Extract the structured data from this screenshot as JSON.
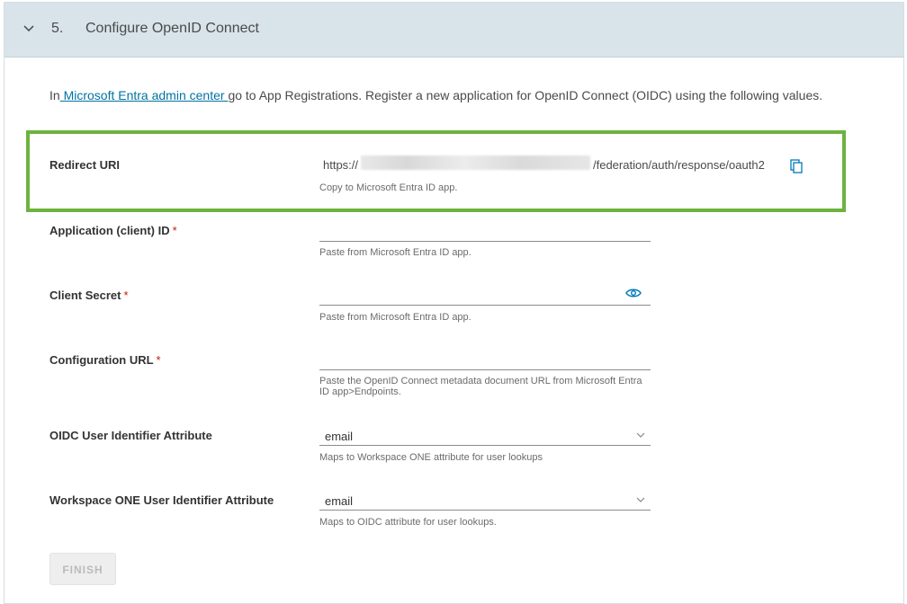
{
  "step": {
    "number": "5.",
    "title": "Configure OpenID Connect",
    "chevron_icon": "chevron-down-icon"
  },
  "intro": {
    "prefix": "In",
    "link_text": " Microsoft Entra admin center ",
    "suffix": "go to App Registrations. Register a new application for OpenID Connect (OIDC) using the following values."
  },
  "redirect_uri": {
    "label": "Redirect URI",
    "value_prefix": "https://",
    "value_suffix": "/federation/auth/response/oauth2",
    "help": "Copy to Microsoft Entra ID app.",
    "copy_icon": "copy-icon"
  },
  "client_id": {
    "label": "Application (client) ID",
    "required": "*",
    "value": "",
    "help": "Paste from Microsoft Entra ID app."
  },
  "client_secret": {
    "label": "Client Secret",
    "required": "*",
    "value": "",
    "help": "Paste from Microsoft Entra ID app.",
    "eye_icon": "eye-icon"
  },
  "config_url": {
    "label": "Configuration URL",
    "required": "*",
    "value": "",
    "help": "Paste the OpenID Connect metadata document URL from Microsoft Entra ID app>Endpoints."
  },
  "oidc_attr": {
    "label": "OIDC User Identifier Attribute",
    "selected": "email",
    "help": "Maps to Workspace ONE attribute for user lookups"
  },
  "ws1_attr": {
    "label": "Workspace ONE User Identifier Attribute",
    "selected": "email",
    "help": "Maps to OIDC attribute for user lookups."
  },
  "finish": {
    "label": "FINISH"
  },
  "colors": {
    "header_bg": "#d8e4ea",
    "highlight": "#6db33f",
    "link": "#0072a3",
    "required": "#c21d00",
    "icon": "#0079b8"
  }
}
